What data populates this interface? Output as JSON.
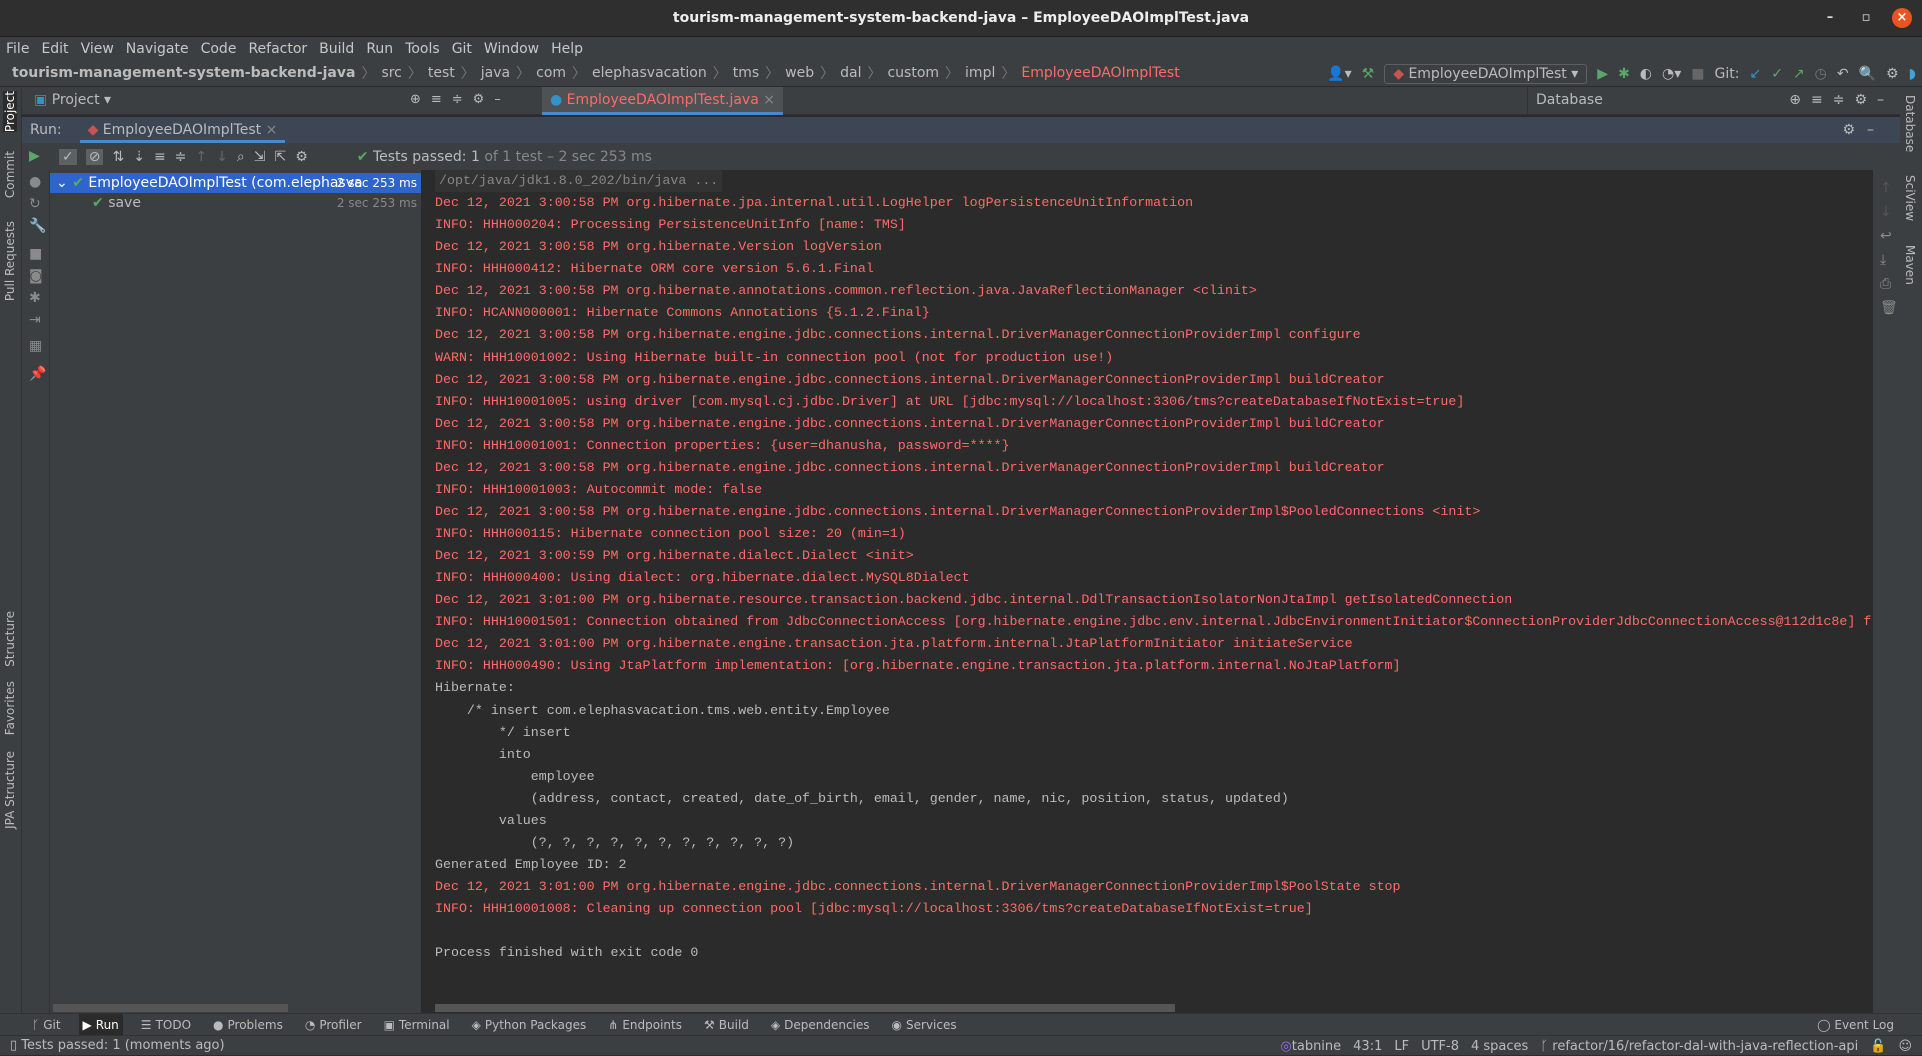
{
  "window": {
    "title": "tourism-management-system-backend-java – EmployeeDAOImplTest.java"
  },
  "menu": [
    "File",
    "Edit",
    "View",
    "Navigate",
    "Code",
    "Refactor",
    "Build",
    "Run",
    "Tools",
    "Git",
    "Window",
    "Help"
  ],
  "breadcrumb": [
    "tourism-management-system-backend-java",
    "src",
    "test",
    "java",
    "com",
    "elephasvacation",
    "tms",
    "web",
    "dal",
    "custom",
    "impl",
    "EmployeeDAOImplTest"
  ],
  "toolbar": {
    "run_config": "EmployeeDAOImplTest",
    "git_label": "Git:"
  },
  "panels": {
    "project": "Project",
    "editor_tab": "EmployeeDAOImplTest.java",
    "database": "Database"
  },
  "left_strip": [
    "Project",
    "Commit",
    "Pull Requests",
    "Structure",
    "Favorites",
    "JPA Structure"
  ],
  "right_strip": [
    "Database",
    "SciView",
    "Maven"
  ],
  "run": {
    "label": "Run:",
    "tab": "EmployeeDAOImplTest",
    "status_prefix": "Tests passed:",
    "status_count": "1",
    "status_suffix": "of 1 test – 2 sec 253 ms"
  },
  "tree": [
    {
      "label": "EmployeeDAOImplTest (com.elephasva",
      "time": "2 sec 253 ms"
    },
    {
      "label": "save",
      "time": "2 sec 253 ms"
    }
  ],
  "console": [
    {
      "t": "/opt/java/jdk1.8.0_202/bin/java ...",
      "c": "cmd"
    },
    {
      "t": "Dec 12, 2021 3:00:58 PM org.hibernate.jpa.internal.util.LogHelper logPersistenceUnitInformation",
      "c": "red"
    },
    {
      "t": "INFO: HHH000204: Processing PersistenceUnitInfo [name: TMS]",
      "c": "red"
    },
    {
      "t": "Dec 12, 2021 3:00:58 PM org.hibernate.Version logVersion",
      "c": "red"
    },
    {
      "t": "INFO: HHH000412: Hibernate ORM core version 5.6.1.Final",
      "c": "red"
    },
    {
      "t": "Dec 12, 2021 3:00:58 PM org.hibernate.annotations.common.reflection.java.JavaReflectionManager <clinit>",
      "c": "red"
    },
    {
      "t": "INFO: HCANN000001: Hibernate Commons Annotations {5.1.2.Final}",
      "c": "red"
    },
    {
      "t": "Dec 12, 2021 3:00:58 PM org.hibernate.engine.jdbc.connections.internal.DriverManagerConnectionProviderImpl configure",
      "c": "red"
    },
    {
      "t": "WARN: HHH10001002: Using Hibernate built-in connection pool (not for production use!)",
      "c": "red"
    },
    {
      "t": "Dec 12, 2021 3:00:58 PM org.hibernate.engine.jdbc.connections.internal.DriverManagerConnectionProviderImpl buildCreator",
      "c": "red"
    },
    {
      "t": "INFO: HHH10001005: using driver [com.mysql.cj.jdbc.Driver] at URL [jdbc:mysql://localhost:3306/tms?createDatabaseIfNotExist=true]",
      "c": "red"
    },
    {
      "t": "Dec 12, 2021 3:00:58 PM org.hibernate.engine.jdbc.connections.internal.DriverManagerConnectionProviderImpl buildCreator",
      "c": "red"
    },
    {
      "t": "INFO: HHH10001001: Connection properties: {user=dhanusha, password=****}",
      "c": "red"
    },
    {
      "t": "Dec 12, 2021 3:00:58 PM org.hibernate.engine.jdbc.connections.internal.DriverManagerConnectionProviderImpl buildCreator",
      "c": "red"
    },
    {
      "t": "INFO: HHH10001003: Autocommit mode: false",
      "c": "red"
    },
    {
      "t": "Dec 12, 2021 3:00:58 PM org.hibernate.engine.jdbc.connections.internal.DriverManagerConnectionProviderImpl$PooledConnections <init>",
      "c": "red"
    },
    {
      "t": "INFO: HHH000115: Hibernate connection pool size: 20 (min=1)",
      "c": "red"
    },
    {
      "t": "Dec 12, 2021 3:00:59 PM org.hibernate.dialect.Dialect <init>",
      "c": "red"
    },
    {
      "t": "INFO: HHH000400: Using dialect: org.hibernate.dialect.MySQL8Dialect",
      "c": "red"
    },
    {
      "t": "Dec 12, 2021 3:01:00 PM org.hibernate.resource.transaction.backend.jdbc.internal.DdlTransactionIsolatorNonJtaImpl getIsolatedConnection",
      "c": "red"
    },
    {
      "t": "INFO: HHH10001501: Connection obtained from JdbcConnectionAccess [org.hibernate.engine.jdbc.env.internal.JdbcEnvironmentInitiator$ConnectionProviderJdbcConnectionAccess@112d1c8e] f",
      "c": "red"
    },
    {
      "t": "Dec 12, 2021 3:01:00 PM org.hibernate.engine.transaction.jta.platform.internal.JtaPlatformInitiator initiateService",
      "c": "red"
    },
    {
      "t": "INFO: HHH000490: Using JtaPlatform implementation: [org.hibernate.engine.transaction.jta.platform.internal.NoJtaPlatform]",
      "c": "red"
    },
    {
      "t": "Hibernate: ",
      "c": "norm"
    },
    {
      "t": "    /* insert com.elephasvacation.tms.web.entity.Employee",
      "c": "norm"
    },
    {
      "t": "        */ insert ",
      "c": "norm"
    },
    {
      "t": "        into",
      "c": "norm"
    },
    {
      "t": "            employee",
      "c": "norm"
    },
    {
      "t": "            (address, contact, created, date_of_birth, email, gender, name, nic, position, status, updated) ",
      "c": "norm"
    },
    {
      "t": "        values",
      "c": "norm"
    },
    {
      "t": "            (?, ?, ?, ?, ?, ?, ?, ?, ?, ?, ?)",
      "c": "norm"
    },
    {
      "t": "Generated Employee ID: 2",
      "c": "norm"
    },
    {
      "t": "Dec 12, 2021 3:01:00 PM org.hibernate.engine.jdbc.connections.internal.DriverManagerConnectionProviderImpl$PoolState stop",
      "c": "red"
    },
    {
      "t": "INFO: HHH10001008: Cleaning up connection pool [jdbc:mysql://localhost:3306/tms?createDatabaseIfNotExist=true]",
      "c": "red"
    },
    {
      "t": "",
      "c": "norm"
    },
    {
      "t": "Process finished with exit code 0",
      "c": "norm"
    }
  ],
  "bottom_tabs": [
    "Git",
    "Run",
    "TODO",
    "Problems",
    "Profiler",
    "Terminal",
    "Python Packages",
    "Endpoints",
    "Build",
    "Dependencies",
    "Services"
  ],
  "event_log": "Event Log",
  "status": {
    "message": "Tests passed: 1 (moments ago)",
    "tabnine": "tabnine",
    "position": "43:1",
    "line_sep": "LF",
    "encoding": "UTF-8",
    "indent": "4 spaces",
    "branch": "refactor/16/refactor-dal-with-java-reflection-api"
  },
  "colors": {
    "error_text": "#ff6b68",
    "pass_green": "#59a869",
    "selection": "#2f65ca",
    "close_button": "#e95420"
  }
}
